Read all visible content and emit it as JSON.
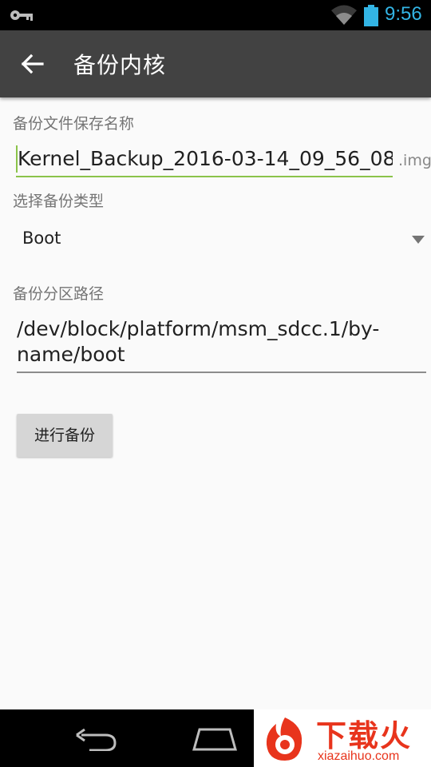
{
  "status_bar": {
    "time": "9:56",
    "icons": [
      "key-icon",
      "wifi-icon",
      "battery-icon"
    ],
    "accent_color": "#33b5e5"
  },
  "app_bar": {
    "title": "备份内核",
    "back_icon": "back-arrow-icon",
    "background": "#424242"
  },
  "form": {
    "filename_label": "备份文件保存名称",
    "filename_value": "Kernel_Backup_2016-03-14_09_56_08",
    "filename_suffix": ".img",
    "type_label": "选择备份类型",
    "type_value": "Boot",
    "path_label": "备份分区路径",
    "path_value": "/dev/block/platform/msm_sdcc.1/by-name/boot",
    "focus_color": "#8bc34a"
  },
  "actions": {
    "backup_button": "进行备份"
  },
  "nav_bar": {
    "icons": [
      "back-icon",
      "home-icon"
    ]
  },
  "watermark": {
    "text": "下载火",
    "sub": "xiazaihuo.com",
    "color": "#e8341c"
  }
}
